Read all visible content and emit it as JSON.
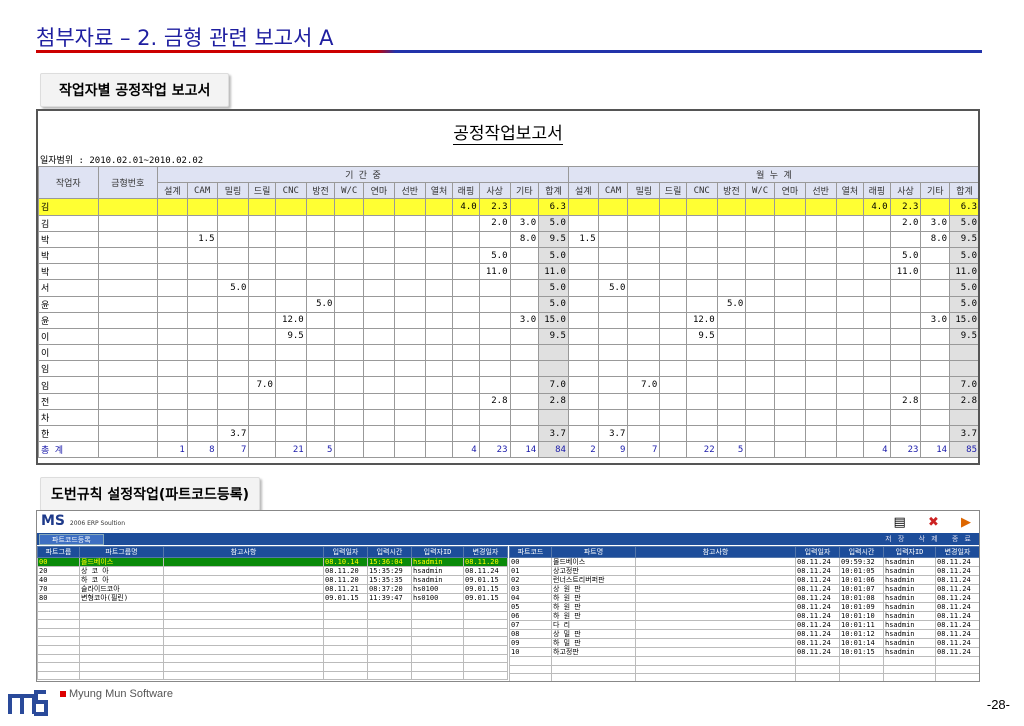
{
  "page": {
    "title": "첨부자료 – 2. 금형 관련 보고서 A",
    "page_number": "-28-"
  },
  "section1": {
    "label": "작업자별 공정작업 보고서"
  },
  "report": {
    "title": "공정작업보고서",
    "range": "일자범위 : 2010.02.01~2010.02.02",
    "h_worker": "작업자",
    "h_mold": "금형번호",
    "h_period": "기 간 중",
    "h_cumul": "월 누 계",
    "cols": [
      "설계",
      "CAM",
      "밀링",
      "드릴",
      "CNC",
      "방전",
      "W/C",
      "연마",
      "선반",
      "열처",
      "래핑",
      "사상",
      "기타",
      "합계"
    ],
    "rows": [
      {
        "name": "김",
        "p": [
          "",
          "",
          "",
          "",
          "",
          "",
          "",
          "",
          "",
          "",
          "4.0",
          "2.3",
          "",
          "6.3"
        ],
        "c": [
          "",
          "",
          "",
          "",
          "",
          "",
          "",
          "",
          "",
          "",
          "4.0",
          "2.3",
          "",
          "6.3"
        ]
      },
      {
        "name": "김",
        "p": [
          "",
          "",
          "",
          "",
          "",
          "",
          "",
          "",
          "",
          "",
          "",
          "2.0",
          "3.0",
          "5.0"
        ],
        "c": [
          "",
          "",
          "",
          "",
          "",
          "",
          "",
          "",
          "",
          "",
          "",
          "2.0",
          "3.0",
          "5.0"
        ]
      },
      {
        "name": "박",
        "p": [
          "",
          "1.5",
          "",
          "",
          "",
          "",
          "",
          "",
          "",
          "",
          "",
          "",
          "8.0",
          "9.5"
        ],
        "c": [
          "1.5",
          "",
          "",
          "",
          "",
          "",
          "",
          "",
          "",
          "",
          "",
          "",
          "8.0",
          "9.5"
        ]
      },
      {
        "name": "박",
        "p": [
          "",
          "",
          "",
          "",
          "",
          "",
          "",
          "",
          "",
          "",
          "",
          "5.0",
          "",
          "5.0"
        ],
        "c": [
          "",
          "",
          "",
          "",
          "",
          "",
          "",
          "",
          "",
          "",
          "",
          "5.0",
          "",
          "5.0"
        ]
      },
      {
        "name": "박",
        "p": [
          "",
          "",
          "",
          "",
          "",
          "",
          "",
          "",
          "",
          "",
          "",
          "11.0",
          "",
          "11.0"
        ],
        "c": [
          "",
          "",
          "",
          "",
          "",
          "",
          "",
          "",
          "",
          "",
          "",
          "11.0",
          "",
          "11.0"
        ]
      },
      {
        "name": "서",
        "p": [
          "",
          "",
          "5.0",
          "",
          "",
          "",
          "",
          "",
          "",
          "",
          "",
          "",
          "",
          "5.0"
        ],
        "c": [
          "",
          "5.0",
          "",
          "",
          "",
          "",
          "",
          "",
          "",
          "",
          "",
          "",
          "",
          "5.0"
        ]
      },
      {
        "name": "윤",
        "p": [
          "",
          "",
          "",
          "",
          "",
          "5.0",
          "",
          "",
          "",
          "",
          "",
          "",
          "",
          "5.0"
        ],
        "c": [
          "",
          "",
          "",
          "",
          "",
          "5.0",
          "",
          "",
          "",
          "",
          "",
          "",
          "",
          "5.0"
        ]
      },
      {
        "name": "윤",
        "p": [
          "",
          "",
          "",
          "",
          "12.0",
          "",
          "",
          "",
          "",
          "",
          "",
          "",
          "3.0",
          "15.0"
        ],
        "c": [
          "",
          "",
          "",
          "",
          "12.0",
          "",
          "",
          "",
          "",
          "",
          "",
          "",
          "3.0",
          "15.0"
        ]
      },
      {
        "name": "이",
        "p": [
          "",
          "",
          "",
          "",
          "9.5",
          "",
          "",
          "",
          "",
          "",
          "",
          "",
          "",
          "9.5"
        ],
        "c": [
          "",
          "",
          "",
          "",
          "9.5",
          "",
          "",
          "",
          "",
          "",
          "",
          "",
          "",
          "9.5"
        ]
      },
      {
        "name": "이",
        "p": [
          "",
          "",
          "",
          "",
          "",
          "",
          "",
          "",
          "",
          "",
          "",
          "",
          "",
          ""
        ],
        "c": [
          "",
          "",
          "",
          "",
          "",
          "",
          "",
          "",
          "",
          "",
          "",
          "",
          "",
          ""
        ]
      },
      {
        "name": "임",
        "p": [
          "",
          "",
          "",
          "",
          "",
          "",
          "",
          "",
          "",
          "",
          "",
          "",
          "",
          ""
        ],
        "c": [
          "",
          "",
          "",
          "",
          "",
          "",
          "",
          "",
          "",
          "",
          "",
          "",
          "",
          ""
        ]
      },
      {
        "name": "임",
        "p": [
          "",
          "",
          "",
          "7.0",
          "",
          "",
          "",
          "",
          "",
          "",
          "",
          "",
          "",
          "7.0"
        ],
        "c": [
          "",
          "",
          "7.0",
          "",
          "",
          "",
          "",
          "",
          "",
          "",
          "",
          "",
          "",
          "7.0"
        ]
      },
      {
        "name": "전",
        "p": [
          "",
          "",
          "",
          "",
          "",
          "",
          "",
          "",
          "",
          "",
          "",
          "2.8",
          "",
          "2.8"
        ],
        "c": [
          "",
          "",
          "",
          "",
          "",
          "",
          "",
          "",
          "",
          "",
          "",
          "2.8",
          "",
          "2.8"
        ]
      },
      {
        "name": "차",
        "p": [
          "",
          "",
          "",
          "",
          "",
          "",
          "",
          "",
          "",
          "",
          "",
          "",
          "",
          ""
        ],
        "c": [
          "",
          "",
          "",
          "",
          "",
          "",
          "",
          "",
          "",
          "",
          "",
          "",
          "",
          ""
        ]
      },
      {
        "name": "한",
        "p": [
          "",
          "",
          "3.7",
          "",
          "",
          "",
          "",
          "",
          "",
          "",
          "",
          "",
          "",
          "3.7"
        ],
        "c": [
          "",
          "3.7",
          "",
          "",
          "",
          "",
          "",
          "",
          "",
          "",
          "",
          "",
          "",
          "3.7"
        ]
      }
    ],
    "total": {
      "name": "총 계",
      "p": [
        "1",
        "8",
        "7",
        "",
        "21",
        "5",
        "",
        "",
        "",
        "",
        "4",
        "23",
        "14",
        "84"
      ],
      "c": [
        "2",
        "9",
        "7",
        "",
        "22",
        "5",
        "",
        "",
        "",
        "",
        "4",
        "23",
        "14",
        "85"
      ]
    }
  },
  "section2": {
    "label": "도번규칙 설정작업(파트코드등록)"
  },
  "erp": {
    "logo": "MS",
    "logo_sub": "2006 ERP Soultion",
    "tab": "파트코드등록",
    "actions": [
      "저 장",
      "삭 제",
      "종 료"
    ],
    "left_headers": [
      "파트그룹",
      "파트그룹명",
      "참고사항",
      "입력일자",
      "입력시간",
      "입력자ID",
      "변경일자"
    ],
    "left_rows": [
      [
        "00",
        "몰드베이스",
        "",
        "08.10.14",
        "15:36:04",
        "hsadmin",
        "08.11.20"
      ],
      [
        "20",
        "상 코 아",
        "",
        "08.11.20",
        "15:35:29",
        "hsadmin",
        "08.11.24"
      ],
      [
        "40",
        "하 코 아",
        "",
        "08.11.20",
        "15:35:35",
        "hsadmin",
        "09.01.15"
      ],
      [
        "70",
        "슬라이드코아",
        "",
        "08.11.21",
        "08:37:20",
        "hs0100",
        "09.01.15"
      ],
      [
        "80",
        "변형코아(필린)",
        "",
        "09.01.15",
        "11:39:47",
        "hs0100",
        "09.01.15"
      ],
      [
        "",
        "",
        "",
        "",
        "",
        "",
        ""
      ],
      [
        "",
        "",
        "",
        "",
        "",
        "",
        ""
      ],
      [
        "",
        "",
        "",
        "",
        "",
        "",
        ""
      ],
      [
        "",
        "",
        "",
        "",
        "",
        "",
        ""
      ],
      [
        "",
        "",
        "",
        "",
        "",
        "",
        ""
      ],
      [
        "",
        "",
        "",
        "",
        "",
        "",
        ""
      ],
      [
        "",
        "",
        "",
        "",
        "",
        "",
        ""
      ],
      [
        "",
        "",
        "",
        "",
        "",
        "",
        ""
      ],
      [
        "",
        "",
        "",
        "",
        "",
        "",
        ""
      ]
    ],
    "right_headers": [
      "파트코드",
      "파트명",
      "참고사항",
      "입력일자",
      "입력시간",
      "입력자ID",
      "변경일자"
    ],
    "right_rows": [
      [
        "00",
        "몰드베이스",
        "",
        "08.11.24",
        "09:59:32",
        "hsadmin",
        "08.11.24"
      ],
      [
        "01",
        "상고정판",
        "",
        "08.11.24",
        "10:01:05",
        "hsadmin",
        "08.11.24"
      ],
      [
        "02",
        "런너스트리버퍼판",
        "",
        "08.11.24",
        "10:01:06",
        "hsadmin",
        "08.11.24"
      ],
      [
        "03",
        "상 원 판",
        "",
        "08.11.24",
        "10:01:07",
        "hsadmin",
        "08.11.24"
      ],
      [
        "04",
        "하 원 판",
        "",
        "08.11.24",
        "10:01:08",
        "hsadmin",
        "08.11.24"
      ],
      [
        "05",
        "하 원 판",
        "",
        "08.11.24",
        "10:01:09",
        "hsadmin",
        "08.11.24"
      ],
      [
        "06",
        "하 원 판",
        "",
        "08.11.24",
        "10:01:10",
        "hsadmin",
        "08.11.24"
      ],
      [
        "07",
        "다 리",
        "",
        "08.11.24",
        "10:01:11",
        "hsadmin",
        "08.11.24"
      ],
      [
        "08",
        "상 밀 판",
        "",
        "08.11.24",
        "10:01:12",
        "hsadmin",
        "08.11.24"
      ],
      [
        "09",
        "하 밀 판",
        "",
        "08.11.24",
        "10:01:14",
        "hsadmin",
        "08.11.24"
      ],
      [
        "10",
        "하고정판",
        "",
        "08.11.24",
        "10:01:15",
        "hsadmin",
        "08.11.24"
      ],
      [
        "",
        "",
        "",
        "",
        "",
        "",
        ""
      ],
      [
        "",
        "",
        "",
        "",
        "",
        "",
        ""
      ],
      [
        "",
        "",
        "",
        "",
        "",
        "",
        ""
      ]
    ]
  },
  "footer": {
    "company": "Myung Mun Software"
  }
}
